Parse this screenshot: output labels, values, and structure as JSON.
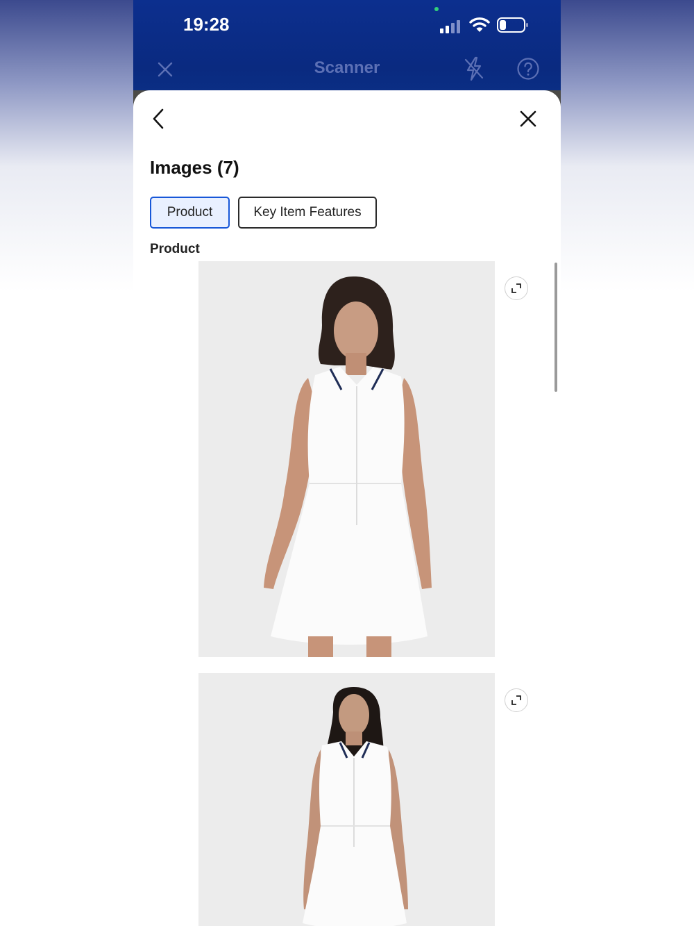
{
  "status_bar": {
    "time": "19:28",
    "icons": [
      "signal-icon",
      "wifi-icon",
      "battery-icon"
    ]
  },
  "app_bar": {
    "title": "Scanner",
    "icons": [
      "close-icon",
      "flash-off-icon",
      "help-icon"
    ],
    "background": "#0b2c87",
    "title_color": "#5c70b5"
  },
  "sheet": {
    "title": "Images (7)",
    "icons": [
      "chevron-left-icon",
      "close-icon"
    ],
    "tabs": [
      {
        "label": "Product",
        "selected": true
      },
      {
        "label": "Key Item Features",
        "selected": false
      }
    ],
    "section_label": "Product",
    "images": [
      {
        "subject": "woman in white sleeveless zip polo tennis dress, front view"
      },
      {
        "subject": "woman in white sleeveless zip polo tennis dress, front view, full length"
      }
    ],
    "accent_color": "#1757d8"
  }
}
